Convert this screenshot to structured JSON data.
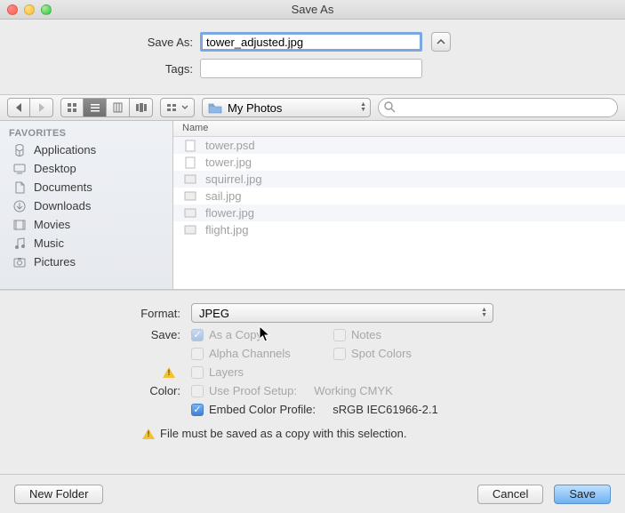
{
  "window": {
    "title": "Save As"
  },
  "form": {
    "saveas_label": "Save As:",
    "saveas_value": "tower_adjusted.jpg",
    "tags_label": "Tags:",
    "tags_value": ""
  },
  "toolbar": {
    "path_label": "My Photos",
    "search_placeholder": ""
  },
  "sidebar": {
    "header": "FAVORITES",
    "items": [
      {
        "label": "Applications",
        "icon": "apps"
      },
      {
        "label": "Desktop",
        "icon": "desktop"
      },
      {
        "label": "Documents",
        "icon": "docs"
      },
      {
        "label": "Downloads",
        "icon": "downloads"
      },
      {
        "label": "Movies",
        "icon": "movies"
      },
      {
        "label": "Music",
        "icon": "music"
      },
      {
        "label": "Pictures",
        "icon": "pictures"
      }
    ]
  },
  "filelist": {
    "header": "Name",
    "rows": [
      {
        "name": "tower.psd"
      },
      {
        "name": "tower.jpg"
      },
      {
        "name": "squirrel.jpg"
      },
      {
        "name": "sail.jpg"
      },
      {
        "name": "flower.jpg"
      },
      {
        "name": "flight.jpg"
      }
    ]
  },
  "options": {
    "format_label": "Format:",
    "format_value": "JPEG",
    "save_label": "Save:",
    "as_a_copy": "As a Copy",
    "notes": "Notes",
    "alpha": "Alpha Channels",
    "spot": "Spot Colors",
    "layers": "Layers",
    "color_label": "Color:",
    "proof": "Use Proof Setup:",
    "proof_val": "Working CMYK",
    "embed": "Embed Color Profile:",
    "embed_val": "sRGB IEC61966-2.1",
    "warning_text": "File must be saved as a copy with this selection."
  },
  "footer": {
    "new_folder": "New Folder",
    "cancel": "Cancel",
    "save": "Save"
  }
}
